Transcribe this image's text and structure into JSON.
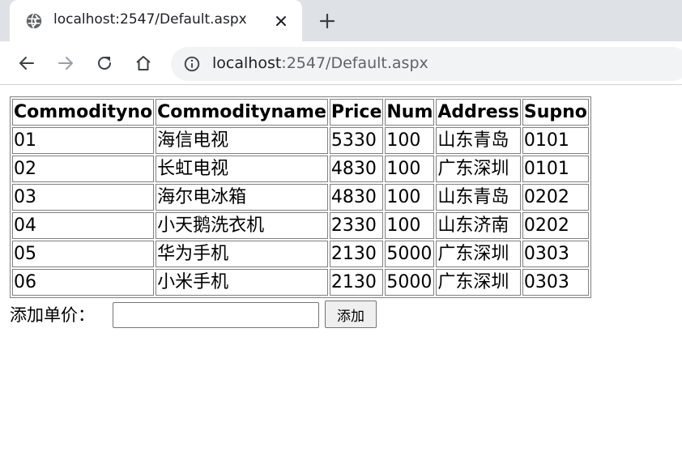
{
  "browser": {
    "tab_title": "localhost:2547/Default.aspx",
    "url_host": "localhost",
    "url_rest": ":2547/Default.aspx"
  },
  "table": {
    "headers": [
      "Commodityno",
      "Commodityname",
      "Price",
      "Num",
      "Address",
      "Supno"
    ],
    "rows": [
      [
        "01",
        "海信电视",
        "5330",
        "100",
        "山东青岛",
        "0101"
      ],
      [
        "02",
        "长虹电视",
        "4830",
        "100",
        "广东深圳",
        "0101"
      ],
      [
        "03",
        "海尔电冰箱",
        "4830",
        "100",
        "山东青岛",
        "0202"
      ],
      [
        "04",
        "小天鹅洗衣机",
        "2330",
        "100",
        "山东济南",
        "0202"
      ],
      [
        "05",
        "华为手机",
        "2130",
        "5000",
        "广东深圳",
        "0303"
      ],
      [
        "06",
        "小米手机",
        "2130",
        "5000",
        "广东深圳",
        "0303"
      ]
    ]
  },
  "form": {
    "label": "添加单价：",
    "input_value": "",
    "button_label": "添加"
  }
}
